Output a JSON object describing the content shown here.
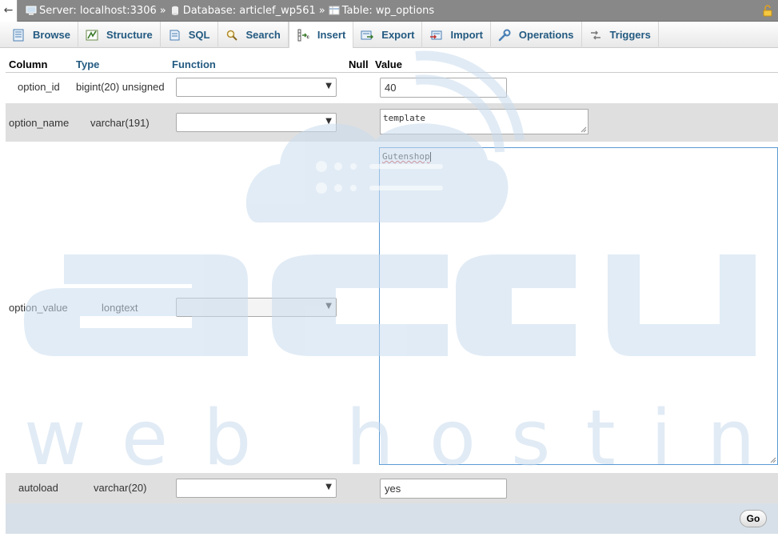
{
  "topbar": {
    "back_icon": "arrow-left-icon",
    "server_label": "Server: localhost:3306",
    "database_label": "Database: articlef_wp561",
    "table_label": "Table: wp_options",
    "separator": "»"
  },
  "tabs": [
    {
      "label": "Browse",
      "icon": "browse-icon"
    },
    {
      "label": "Structure",
      "icon": "structure-icon"
    },
    {
      "label": "SQL",
      "icon": "sql-icon"
    },
    {
      "label": "Search",
      "icon": "search-icon"
    },
    {
      "label": "Insert",
      "icon": "insert-icon",
      "active": true
    },
    {
      "label": "Export",
      "icon": "export-icon"
    },
    {
      "label": "Import",
      "icon": "import-icon"
    },
    {
      "label": "Operations",
      "icon": "wrench-icon"
    },
    {
      "label": "Triggers",
      "icon": "triggers-icon"
    }
  ],
  "table": {
    "headers": {
      "column": "Column",
      "type": "Type",
      "function": "Function",
      "null": "Null",
      "value": "Value"
    },
    "rows": [
      {
        "column": "option_id",
        "type": "bigint(20) unsigned",
        "function": "",
        "value": "40"
      },
      {
        "column": "option_name",
        "type": "varchar(191)",
        "function": "",
        "value": "template"
      },
      {
        "column": "option_value",
        "type": "longtext",
        "function": "",
        "value": "Gutenshop"
      },
      {
        "column": "autoload",
        "type": "varchar(20)",
        "function": "",
        "value": "yes"
      }
    ]
  },
  "go_button": "Go",
  "watermark": {
    "line1": "accu",
    "line2": "web hosting"
  },
  "colors": {
    "link": "#235a81",
    "topbar": "#888888",
    "even_row": "#dfdfdf",
    "focus": "#5b9bd5",
    "watermark": "#e3edf6"
  }
}
